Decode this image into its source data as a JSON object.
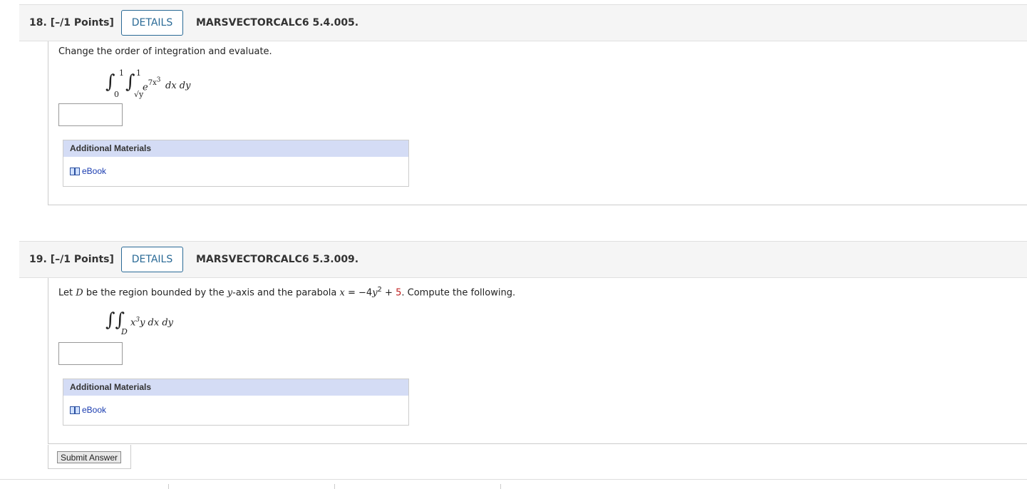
{
  "q18": {
    "number": "18.",
    "points": "[–/1 Points]",
    "details_label": "DETAILS",
    "code": "MARSVECTORCALC6 5.4.005.",
    "prompt": "Change the order of integration and evaluate.",
    "integral": {
      "outer_upper": "1",
      "outer_lower": "0",
      "inner_upper": "1",
      "inner_lower": "√y",
      "integrand_base": "e",
      "integrand_exp": "7x",
      "integrand_exp_power": "3",
      "differentials": "dx dy"
    },
    "answer_value": "",
    "additional_materials_label": "Additional Materials",
    "ebook_label": "eBook"
  },
  "q19": {
    "number": "19.",
    "points": "[–/1 Points]",
    "details_label": "DETAILS",
    "code": "MARSVECTORCALC6 5.3.009.",
    "prompt": {
      "p1": "Let ",
      "D": "D",
      "p2": " be the region bounded by the ",
      "y": "y",
      "p3": "-axis and the parabola ",
      "x": "x",
      "p4": " = −4",
      "y2": "y",
      "sup2": "2",
      "p5": " + ",
      "five": "5",
      "p6": ". Compute the following."
    },
    "integral": {
      "region": "D",
      "integrand_x": "x",
      "integrand_pow": "3",
      "integrand_rest": "y dx dy"
    },
    "answer_value": "",
    "additional_materials_label": "Additional Materials",
    "ebook_label": "eBook"
  },
  "submit_label": "Submit Answer",
  "colors": {
    "details_border": "#2a6a96",
    "additional_header_bg": "#d4dcf5",
    "link": "#1a3cb0",
    "highlight_red": "#c02020"
  }
}
